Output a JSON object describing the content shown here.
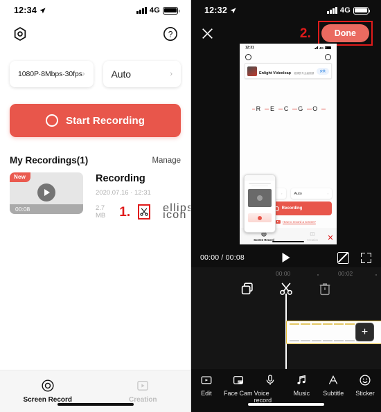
{
  "left": {
    "status": {
      "time": "12:34",
      "network": "4G"
    },
    "header": {
      "settings_icon": "gear-icon",
      "help_icon": "question-circle-icon"
    },
    "options": [
      {
        "label": "1080P·8Mbps·30fps",
        "chevron": "›"
      },
      {
        "label": "Auto",
        "chevron": "›"
      }
    ],
    "record_button": {
      "label": "Start Recording",
      "color": "#e8564b"
    },
    "section": {
      "title": "My Recordings(1)",
      "manage": "Manage"
    },
    "recording": {
      "badge": "New",
      "duration": "00:08",
      "name": "Recording",
      "date": "2020.07.16 · 12:31",
      "size": "2.7 MB",
      "step_marker": "1.",
      "cut_icon": "scissors-icon",
      "more_icon": "ellipsis-icon"
    },
    "tabs": [
      {
        "label": "Screen Record",
        "icon": "record-circle-icon",
        "active": true
      },
      {
        "label": "Creation",
        "icon": "play-frame-icon",
        "active": false
      }
    ]
  },
  "right": {
    "status": {
      "time": "12:32",
      "network": "4G"
    },
    "header": {
      "close_icon": "close-x-icon",
      "step_marker": "2.",
      "done_label": "Done",
      "done_color": "#ea6a60",
      "highlight_color": "#e01b1b"
    },
    "preview": {
      "status_time": "12:31",
      "status_net": "4G",
      "ad": {
        "title": "Enlight Videoleap",
        "subtitle": "超清的专业级视频",
        "cta": "安装",
        "tag": "广告"
      },
      "logo_letters": [
        "R",
        "E",
        "C",
        "G",
        "O"
      ],
      "options": [
        {
          "label": "1080P·8Mbps·30fps"
        },
        {
          "label": "Auto"
        }
      ],
      "record_label": "Recording",
      "link_text": "How to record a screen?",
      "tabs": [
        {
          "label": "Screen Record",
          "active": true
        },
        {
          "label": "Creation",
          "active": false
        }
      ],
      "close_icon": "close-x-icon"
    },
    "playback": {
      "time": "00:00 / 00:08",
      "play_icon": "play-icon",
      "ratio_icon": "aspect-ratio-icon",
      "fullscreen_icon": "fullscreen-icon"
    },
    "ruler_ticks": [
      "00:00",
      "00:02"
    ],
    "tools": [
      {
        "name": "duplicate-icon",
        "label": "Duplicate"
      },
      {
        "name": "scissors-icon",
        "label": "Cut"
      },
      {
        "name": "trash-icon",
        "label": "Delete"
      }
    ],
    "timeline": {
      "add_label": "+",
      "clip_color": "#fdfdfd",
      "clip_border": "#e8c03a"
    },
    "bottom_tabs": [
      {
        "label": "Edit",
        "icon": "edit-frame-icon"
      },
      {
        "label": "Face Cam",
        "icon": "face-cam-icon"
      },
      {
        "label": "Voice record",
        "icon": "microphone-icon"
      },
      {
        "label": "Music",
        "icon": "music-note-icon"
      },
      {
        "label": "Subtitle",
        "icon": "letter-a-icon"
      },
      {
        "label": "Sticker",
        "icon": "smiley-icon"
      }
    ]
  }
}
